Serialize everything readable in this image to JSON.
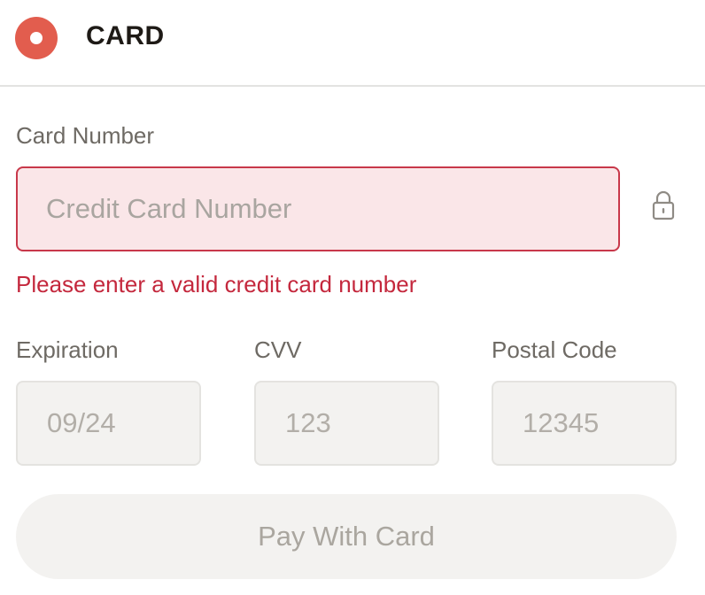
{
  "header": {
    "title": "CARD",
    "radio_color": "#e25d4e"
  },
  "card_number": {
    "label": "Card Number",
    "placeholder": "Credit Card Number",
    "value": "",
    "error": "Please enter a valid credit card number",
    "lock_icon": "lock-icon"
  },
  "expiration": {
    "label": "Expiration",
    "placeholder": "09/24",
    "value": ""
  },
  "cvv": {
    "label": "CVV",
    "placeholder": "123",
    "value": ""
  },
  "postal_code": {
    "label": "Postal Code",
    "placeholder": "12345",
    "value": ""
  },
  "pay_button": {
    "label": "Pay With Card",
    "disabled": true
  },
  "colors": {
    "error": "#c4283d",
    "error_background": "#fae6e8",
    "input_background": "#f3f2f0"
  }
}
